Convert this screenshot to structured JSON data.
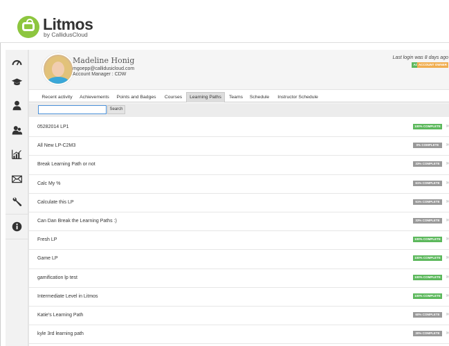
{
  "header": {
    "logo_title": "Litmos",
    "logo_subtitle": "by CallidusCloud"
  },
  "sidebar": {
    "items": [
      {
        "icon": "dashboard-icon"
      },
      {
        "icon": "graduation-cap-icon"
      },
      {
        "icon": "user-icon"
      },
      {
        "icon": "users-icon"
      },
      {
        "icon": "reports-chart-icon"
      },
      {
        "icon": "envelope-icon"
      },
      {
        "icon": "wrench-icon"
      },
      {
        "icon": "info-icon"
      }
    ]
  },
  "profile": {
    "name": "Madeline Honig",
    "email": "mgoepp@callidusicloud.com",
    "manager": "Account Manager : CDW",
    "last_login": "Last login was 8 days ago",
    "badges": [
      "ACTIVE",
      "ACCOUNT OWNER"
    ]
  },
  "tabs": [
    {
      "label": "Recent activity",
      "active": false
    },
    {
      "label": "Achievements",
      "active": false
    },
    {
      "label": "Points and Badges",
      "active": false
    },
    {
      "label": "Courses",
      "active": false
    },
    {
      "label": "Learning Paths",
      "active": true
    },
    {
      "label": "Teams",
      "active": false
    },
    {
      "label": "Schedule",
      "active": false
    },
    {
      "label": "Instructor Schedule",
      "active": false
    }
  ],
  "search": {
    "value": "",
    "placeholder": "",
    "button_label": "Search"
  },
  "colors": {
    "complete": "#5cb85c",
    "incomplete": "#999999",
    "brand": "#8dc63f",
    "owner": "#f0ad4e"
  },
  "learning_paths": [
    {
      "name": "05282014 LP1",
      "status": "100% COMPLETE",
      "percent": 100
    },
    {
      "name": "All New LP-C2M3",
      "status": "0% COMPLETE",
      "percent": 0
    },
    {
      "name": "Break Learning Path or not",
      "status": "33% COMPLETE",
      "percent": 33
    },
    {
      "name": "Calc My %",
      "status": "61% COMPLETE",
      "percent": 61
    },
    {
      "name": "Calculate this LP",
      "status": "51% COMPLETE",
      "percent": 51
    },
    {
      "name": "Can Dan Break the Learning Paths :)",
      "status": "33% COMPLETE",
      "percent": 33
    },
    {
      "name": "Fresh LP",
      "status": "100% COMPLETE",
      "percent": 100
    },
    {
      "name": "Game LP",
      "status": "100% COMPLETE",
      "percent": 100
    },
    {
      "name": "gamification lp test",
      "status": "100% COMPLETE",
      "percent": 100
    },
    {
      "name": "Intermediate Level in Litmos",
      "status": "100% COMPLETE",
      "percent": 100
    },
    {
      "name": "Katie's Learning Path",
      "status": "60% COMPLETE",
      "percent": 60
    },
    {
      "name": "kyle 3rd learning path",
      "status": "30% COMPLETE",
      "percent": 30
    }
  ]
}
